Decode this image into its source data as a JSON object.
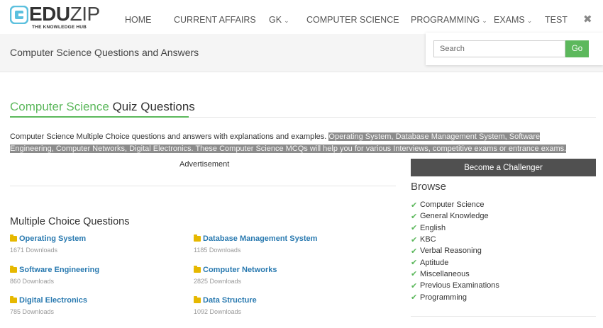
{
  "logo": {
    "brand_prefix": "EDU",
    "brand_suffix": "ZIP",
    "tagline": "THE KNOWLEDGE HUB",
    "mark_color": "#5bc0de"
  },
  "nav": {
    "items": [
      {
        "label": "HOME",
        "dropdown": false
      },
      {
        "label": "CURRENT AFFAIRS",
        "dropdown": false
      },
      {
        "label": "GK",
        "dropdown": true
      },
      {
        "label": "COMPUTER SCIENCE",
        "dropdown": false
      },
      {
        "label": "PROGRAMMING",
        "dropdown": true
      },
      {
        "label": "EXAMS",
        "dropdown": true
      },
      {
        "label": "TEST",
        "dropdown": false
      }
    ],
    "caret": "⌄",
    "close_glyph": "✖"
  },
  "page_title": "Computer Science Questions and Answers",
  "search": {
    "placeholder": "Search",
    "button_label": "Go"
  },
  "section": {
    "heading_accent": "Computer Science",
    "heading_rest": " Quiz Questions",
    "intro_plain": "Computer Science Multiple Choice questions and answers with explanations and examples. ",
    "intro_highlighted": "Operating System, Database Management System, Software Engineering, Computer Networks, Digital Electronics. These Computer Science MCQs will help you for various Interviews, competitive exams or entrance exams."
  },
  "advertisement_label": "Advertisement",
  "mcq": {
    "heading": "Multiple Choice Questions",
    "categories": [
      {
        "name": "Operating System",
        "downloads": "1671 Downloads"
      },
      {
        "name": "Database Management System",
        "downloads": "1185 Downloads"
      },
      {
        "name": "Software Engineering",
        "downloads": "860 Downloads"
      },
      {
        "name": "Computer Networks",
        "downloads": "2825 Downloads"
      },
      {
        "name": "Digital Electronics",
        "downloads": "785 Downloads"
      },
      {
        "name": "Data Structure",
        "downloads": "1092 Downloads"
      }
    ]
  },
  "sidebar": {
    "challenger_label": "Become a Challenger",
    "browse_title": "Browse",
    "check_glyph": "✔",
    "browse_items": [
      "Computer Science",
      "General Knowledge",
      "English",
      "KBC",
      "Verbal Reasoning",
      "Aptitude",
      "Miscellaneous",
      "Previous Examinations",
      "Programming"
    ]
  },
  "colors": {
    "accent_green": "#5cb85c",
    "link_blue": "#2a7ab0",
    "folder_yellow": "#e6b800",
    "dark_button": "#505050"
  }
}
